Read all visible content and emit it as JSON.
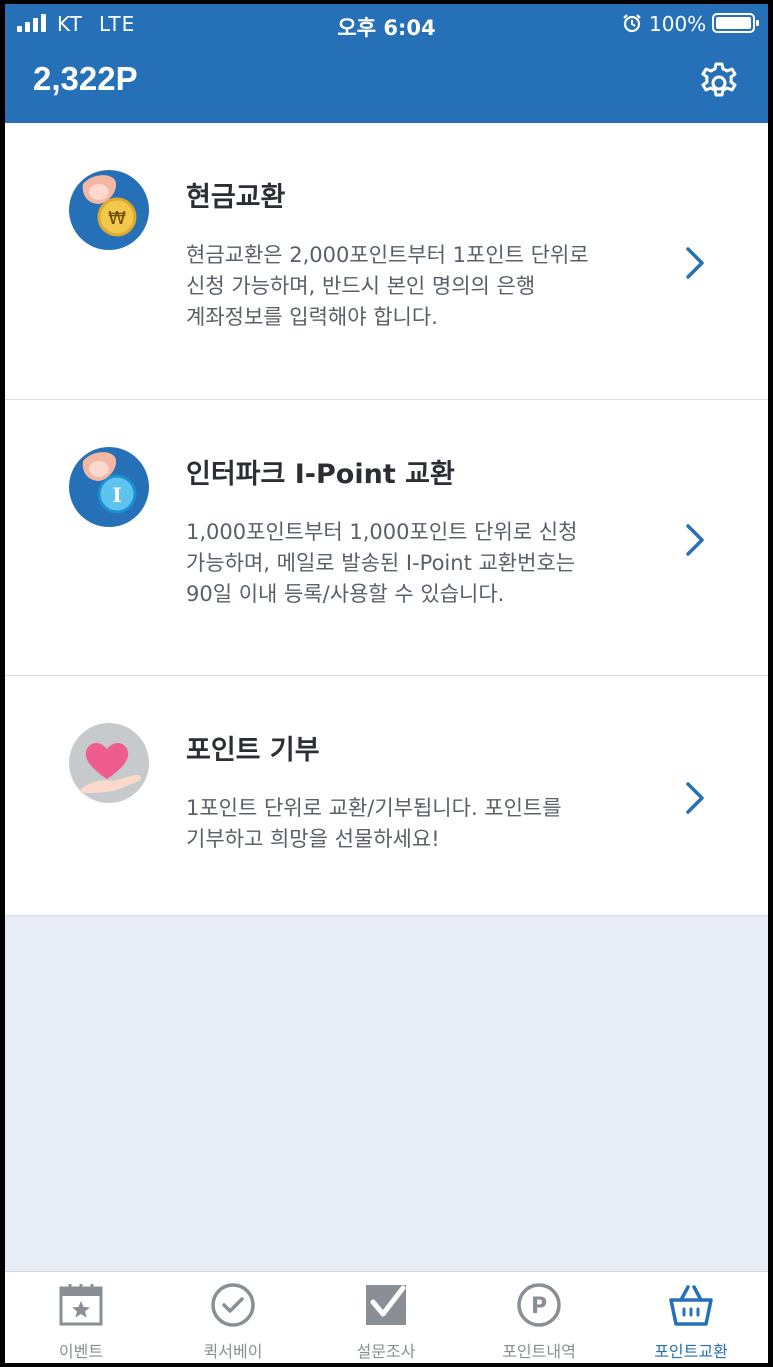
{
  "status_bar": {
    "carrier": "KT",
    "network": "LTE",
    "time": "오후 6:04",
    "battery": "100%"
  },
  "header": {
    "points": "2,322P"
  },
  "colors": {
    "primary": "#2570b6",
    "background": "#e8edf5"
  },
  "items": [
    {
      "icon": "coin-won-icon",
      "title": "현금교환",
      "lines": [
        "현금교환은 2,000포인트부터 1포인트 단위로",
        "신청 가능하며, 반드시 본인 명의의 은행",
        "계좌정보를 입력해야 합니다."
      ]
    },
    {
      "icon": "coin-ipoint-icon",
      "title": "인터파크 I-Point 교환",
      "lines": [
        "1,000포인트부터 1,000포인트 단위로 신청",
        "가능하며, 메일로 발송된 I-Point 교환번호는",
        "90일 이내 등록/사용할 수 있습니다."
      ]
    },
    {
      "icon": "heart-donation-icon",
      "title": "포인트 기부",
      "lines": [
        "1포인트 단위로 교환/기부됩니다. 포인트를",
        "기부하고 희망을 선물하세요!"
      ]
    }
  ],
  "tabs": [
    {
      "label": "이벤트",
      "icon": "calendar-star-icon",
      "active": false
    },
    {
      "label": "퀵서베이",
      "icon": "check-circle-icon",
      "active": false
    },
    {
      "label": "설문조사",
      "icon": "checkbox-icon",
      "active": false
    },
    {
      "label": "포인트내역",
      "icon": "point-p-icon",
      "active": false
    },
    {
      "label": "포인트교환",
      "icon": "shopping-basket-icon",
      "active": true
    }
  ]
}
